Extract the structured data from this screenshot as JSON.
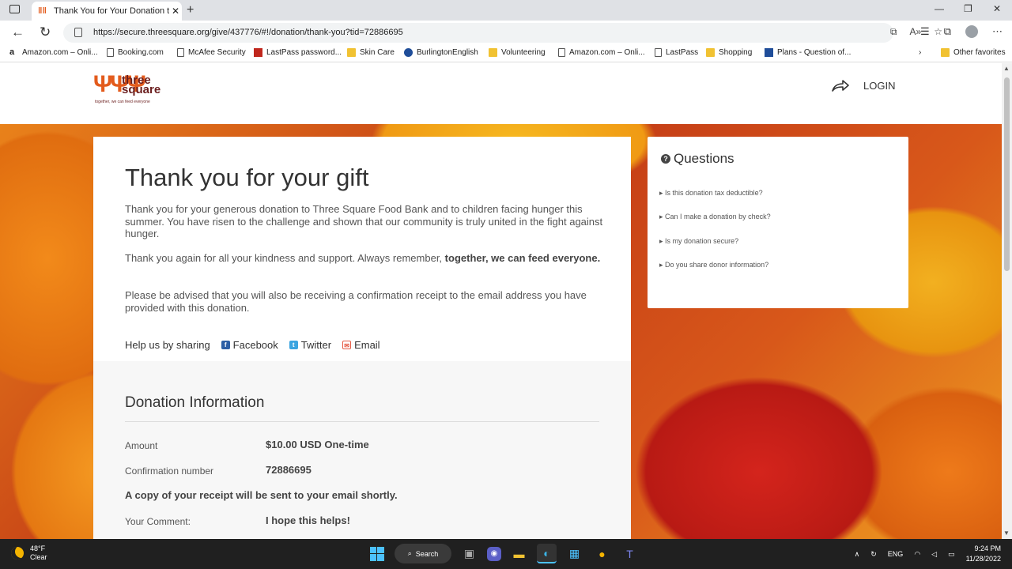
{
  "browser": {
    "tab_title": "Thank You for Your Donation to",
    "url": "https://secure.threesquare.org/give/437776/#!/donation/thank-you?tid=72886695",
    "bookmarks": [
      {
        "label": "Amazon.com – Onli...",
        "icon": "amazon-icon"
      },
      {
        "label": "Booking.com",
        "icon": "page-icon"
      },
      {
        "label": "McAfee Security",
        "icon": "page-icon"
      },
      {
        "label": "LastPass password...",
        "icon": "lastpass-icon"
      },
      {
        "label": "Skin Care",
        "icon": "folder-icon"
      },
      {
        "label": "BurlingtonEnglish",
        "icon": "burlington-icon"
      },
      {
        "label": "Volunteering",
        "icon": "folder-icon"
      },
      {
        "label": "Amazon.com – Onli...",
        "icon": "page-icon"
      },
      {
        "label": "LastPass",
        "icon": "page-icon"
      },
      {
        "label": "Shopping",
        "icon": "folder-icon"
      },
      {
        "label": "Plans - Question of...",
        "icon": "plans-icon"
      }
    ],
    "other_favorites": "Other favorites"
  },
  "site": {
    "logo_word_1": "three",
    "logo_word_2": "square",
    "logo_tagline": "together, we can feed everyone",
    "login_label": "LOGIN"
  },
  "thankyou": {
    "heading": "Thank you for your gift",
    "para1": "Thank you for your generous donation to Three Square Food Bank and to children facing hunger this summer. You have risen to the challenge and shown that our community is truly united in the fight against hunger.",
    "para2_plain": "Thank you again for all your kindness and support. Always remember, ",
    "para2_bold": "together, we can feed everyone.",
    "para3": "Please be advised that you will also be receiving a confirmation receipt to the email address you have provided with this donation.",
    "share_label": "Help us by sharing",
    "share_facebook": "Facebook",
    "share_twitter": "Twitter",
    "share_email": "Email"
  },
  "donation": {
    "heading": "Donation Information",
    "amount_label": "Amount",
    "amount_value": "$10.00 USD One-time",
    "confirmation_label": "Confirmation number",
    "confirmation_value": "72886695",
    "receipt_note": "A copy of your receipt will be sent to your email shortly.",
    "comment_label": "Your Comment:",
    "comment_value": "I hope this helps!"
  },
  "questions": {
    "heading": "Questions",
    "items": [
      "Is this donation tax deductible?",
      "Can I make a donation by check?",
      "Is my donation secure?",
      "Do you share donor information?"
    ]
  },
  "taskbar": {
    "temp": "48°F",
    "condition": "Clear",
    "search_label": "Search",
    "lang": "ENG",
    "time": "9:24 PM",
    "date": "11/28/2022"
  }
}
